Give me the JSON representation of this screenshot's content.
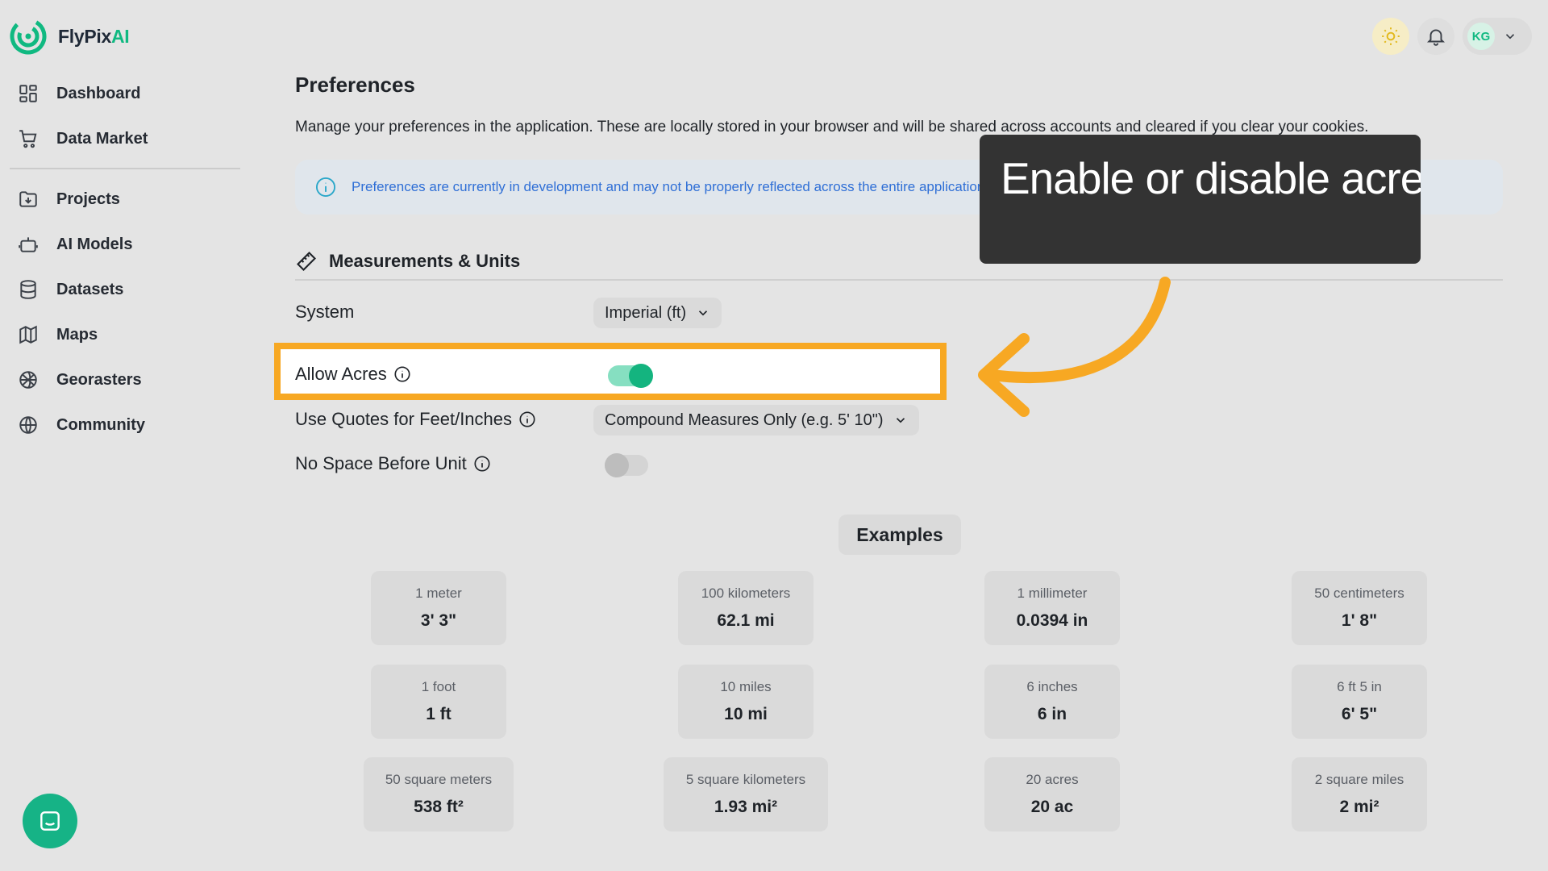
{
  "brand": {
    "name_main": "FlyPix",
    "name_accent": "AI"
  },
  "colors": {
    "accent": "#10b981",
    "highlight": "#f7a823",
    "info_text": "#2f6fd6",
    "tooltip_bg": "#333333"
  },
  "sidebar": {
    "items": [
      {
        "label": "Dashboard",
        "icon": "dashboard-icon"
      },
      {
        "label": "Data Market",
        "icon": "cart-icon"
      },
      {
        "label": "Projects",
        "icon": "folder-icon"
      },
      {
        "label": "AI Models",
        "icon": "robot-icon"
      },
      {
        "label": "Datasets",
        "icon": "database-icon"
      },
      {
        "label": "Maps",
        "icon": "map-icon"
      },
      {
        "label": "Georasters",
        "icon": "globe-grid-icon"
      },
      {
        "label": "Community",
        "icon": "globe-icon"
      }
    ]
  },
  "header": {
    "avatar_initials": "KG"
  },
  "page": {
    "title": "Preferences",
    "description": "Manage your preferences in the application. These are locally stored in your browser and will be shared across accounts and cleared if you clear your cookies.",
    "info_text": "Preferences are currently in development and may not be properly reflected across the entire application. Thank you for your patience."
  },
  "section": {
    "title": "Measurements & Units",
    "rows": {
      "system": {
        "label": "System",
        "value": "Imperial (ft)"
      },
      "allow_acres": {
        "label": "Allow Acres",
        "enabled": true
      },
      "quotes": {
        "label": "Use Quotes for Feet/Inches",
        "value": "Compound Measures Only (e.g. 5' 10\")"
      },
      "no_space": {
        "label": "No Space Before Unit",
        "enabled": false
      }
    }
  },
  "tooltip": {
    "text": "Enable or disable acres"
  },
  "examples": {
    "button_label": "Examples",
    "cards": [
      {
        "label": "1 meter",
        "value": "3' 3\""
      },
      {
        "label": "100 kilometers",
        "value": "62.1 mi"
      },
      {
        "label": "1 millimeter",
        "value": "0.0394 in"
      },
      {
        "label": "50 centimeters",
        "value": "1' 8\""
      },
      {
        "label": "1 foot",
        "value": "1 ft"
      },
      {
        "label": "10 miles",
        "value": "10 mi"
      },
      {
        "label": "6 inches",
        "value": "6 in"
      },
      {
        "label": "6 ft 5 in",
        "value": "6' 5\""
      },
      {
        "label": "50 square meters",
        "value": "538 ft²"
      },
      {
        "label": "5 square kilometers",
        "value": "1.93 mi²"
      },
      {
        "label": "20 acres",
        "value": "20 ac"
      },
      {
        "label": "2 square miles",
        "value": "2 mi²"
      }
    ]
  }
}
